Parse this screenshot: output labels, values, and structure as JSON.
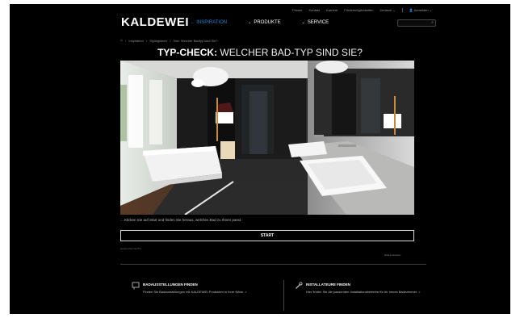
{
  "utility_nav": [
    "Presse",
    "Kontakt",
    "Karriere",
    "Fördermöglichkeiten",
    "Deutsch",
    "Anmelden"
  ],
  "logo": "KALDEWEI",
  "main_nav": [
    {
      "label": "INSPIRATION",
      "active": true
    },
    {
      "label": "PRODUKTE",
      "active": false
    },
    {
      "label": "SERVICE",
      "active": false
    }
  ],
  "search": {
    "placeholder": ""
  },
  "breadcrumb": [
    "Inspiration",
    "Stylingideen",
    "Test: Welcher Badtyp sind Sie?"
  ],
  "title": {
    "bold": "TYP-CHECK:",
    "light": "WELCHER BAD-TYP SIND SIE?"
  },
  "intro": "... Klicken Sie auf Start und finden Sie heraus, welches Bad zu Ihnen passt.",
  "start_label": "START",
  "powered_by": "powered by ConTry",
  "privacy": "Data protection",
  "promos": [
    {
      "icon": "showroom-icon",
      "title": "BADAUSSTELLUNGEN FINDEN",
      "text": "Finden Sie Badausstellungen mit KALDEWEI-Produkten in Ihrer Nähe. >"
    },
    {
      "icon": "wrench-icon",
      "title": "INSTALLATEURE FINDEN",
      "text": "Hier finden Sie die passenden Installationsbetriebe für Ihr neues Badezimmer. >"
    }
  ],
  "colors": {
    "background": "#000000",
    "accent": "#1f86d4",
    "text": "#ffffff"
  }
}
